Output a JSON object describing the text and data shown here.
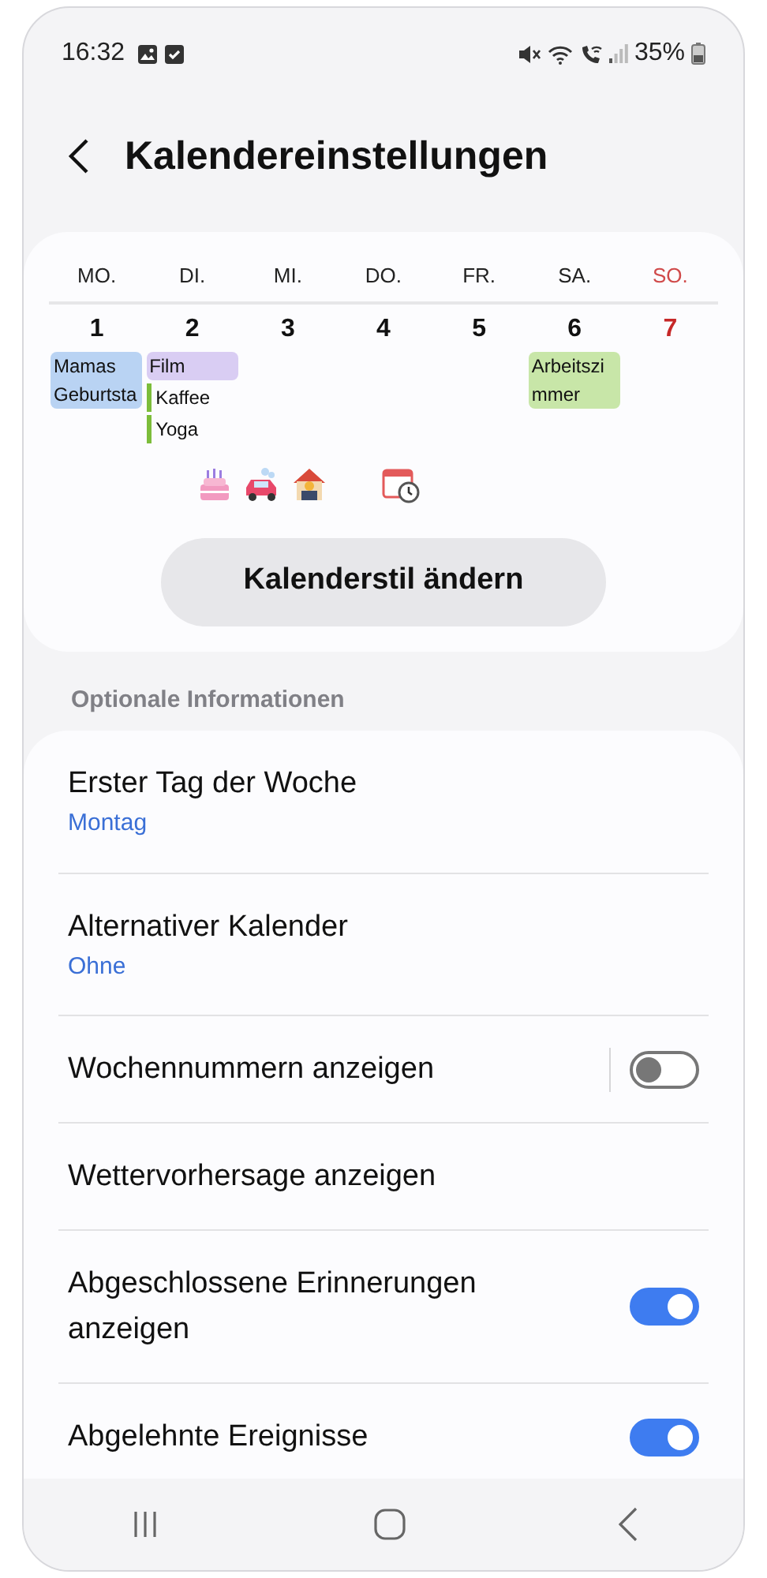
{
  "status_bar": {
    "time": "16:32",
    "battery": "35%"
  },
  "header": {
    "title": "Kalendereinstellungen"
  },
  "calendar": {
    "days": [
      {
        "label": "MO.",
        "color": "#222222"
      },
      {
        "label": "DI.",
        "color": "#222222"
      },
      {
        "label": "MI.",
        "color": "#222222"
      },
      {
        "label": "DO.",
        "color": "#222222"
      },
      {
        "label": "FR.",
        "color": "#222222"
      },
      {
        "label": "SA.",
        "color": "#222222"
      },
      {
        "label": "SO.",
        "color": "#d04a4a"
      }
    ],
    "dates": [
      {
        "label": "1",
        "color": "#111111",
        "events": [
          {
            "kind": "block",
            "lines": [
              "Mamas",
              "Geburtsta"
            ],
            "color": "#b9d3f3"
          }
        ]
      },
      {
        "label": "2",
        "color": "#111111",
        "events": [
          {
            "kind": "block",
            "lines": [
              "Film"
            ],
            "color": "#d9cdf3"
          },
          {
            "kind": "bar",
            "lines": [
              "Kaffee"
            ],
            "color": "#7cbd3a"
          },
          {
            "kind": "bar",
            "lines": [
              "Yoga"
            ],
            "color": "#7cbd3a"
          }
        ]
      },
      {
        "label": "3",
        "color": "#111111"
      },
      {
        "label": "4",
        "color": "#111111"
      },
      {
        "label": "5",
        "color": "#111111"
      },
      {
        "label": "6",
        "color": "#111111",
        "events": [
          {
            "kind": "block",
            "lines": [
              "Arbeitszi",
              "mmer"
            ],
            "color": "#c8e6a8"
          }
        ]
      },
      {
        "label": "7",
        "color": "#c62828"
      }
    ],
    "stickers": [
      {
        "kind": "cake"
      },
      {
        "kind": "car"
      },
      {
        "kind": "house"
      },
      {
        "kind": "calendar"
      }
    ],
    "button": "Kalenderstil ändern"
  },
  "section_label": "Optionale Informationen",
  "settings": [
    {
      "kind": "plain",
      "title": "Erster Tag der Woche",
      "subtitle": "Montag"
    },
    {
      "kind": "plain",
      "title": "Alternativer Kalender",
      "subtitle": "Ohne"
    },
    {
      "kind": "toggle",
      "title": "Wochennummern anzeigen",
      "on": false,
      "separator": true
    },
    {
      "kind": "plain",
      "title": "Wettervorhersage anzeigen"
    },
    {
      "kind": "toggle",
      "title": "Abgeschlossene Erinnerungen anzeigen",
      "on": true,
      "separator": false
    },
    {
      "kind": "toggle",
      "title": "Abgelehnte Ereignisse",
      "on": true,
      "separator": false
    }
  ]
}
